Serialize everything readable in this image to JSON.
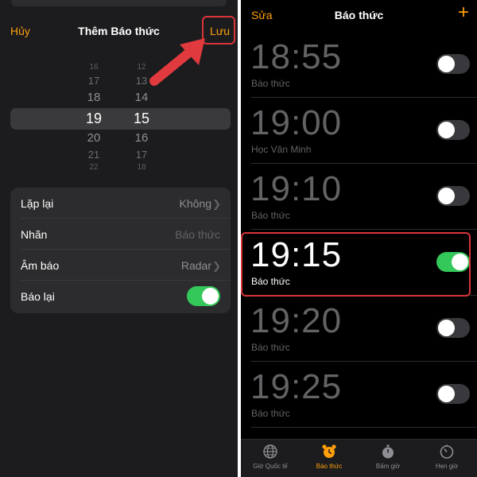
{
  "colors": {
    "accent": "#ff9f0a",
    "toggle_on": "#34c759",
    "highlight": "#d9343a"
  },
  "add_alarm": {
    "cancel_label": "Hủy",
    "title": "Thêm Báo thức",
    "save_label": "Lưu",
    "picker": {
      "hours": [
        "16",
        "17",
        "18",
        "19",
        "20",
        "21",
        "22"
      ],
      "minutes": [
        "12",
        "13",
        "14",
        "15",
        "16",
        "17",
        "18"
      ],
      "selected_hour": "19",
      "selected_minute": "15"
    },
    "settings": {
      "repeat": {
        "label": "Lặp lại",
        "value": "Không"
      },
      "label": {
        "label": "Nhãn",
        "placeholder": "Báo thức"
      },
      "sound": {
        "label": "Âm báo",
        "value": "Radar"
      },
      "snooze": {
        "label": "Báo lại",
        "on": true
      }
    }
  },
  "alarm_list": {
    "edit_label": "Sửa",
    "title": "Báo thức",
    "add_icon": "plus-icon",
    "alarms": [
      {
        "time": "18:55",
        "label": "Báo thức",
        "on": false
      },
      {
        "time": "19:00",
        "label": "Học Văn Minh",
        "on": false
      },
      {
        "time": "19:10",
        "label": "Báo thức",
        "on": false
      },
      {
        "time": "19:15",
        "label": "Báo thức",
        "on": true
      },
      {
        "time": "19:20",
        "label": "Báo thức",
        "on": false
      },
      {
        "time": "19:25",
        "label": "Báo thức",
        "on": false
      }
    ],
    "tabs": [
      {
        "label": "Giờ Quốc tế",
        "icon": "globe-icon",
        "active": false
      },
      {
        "label": "Báo thức",
        "icon": "alarm-clock-icon",
        "active": true
      },
      {
        "label": "Bấm giờ",
        "icon": "stopwatch-icon",
        "active": false
      },
      {
        "label": "Hẹn giờ",
        "icon": "timer-icon",
        "active": false
      }
    ]
  }
}
